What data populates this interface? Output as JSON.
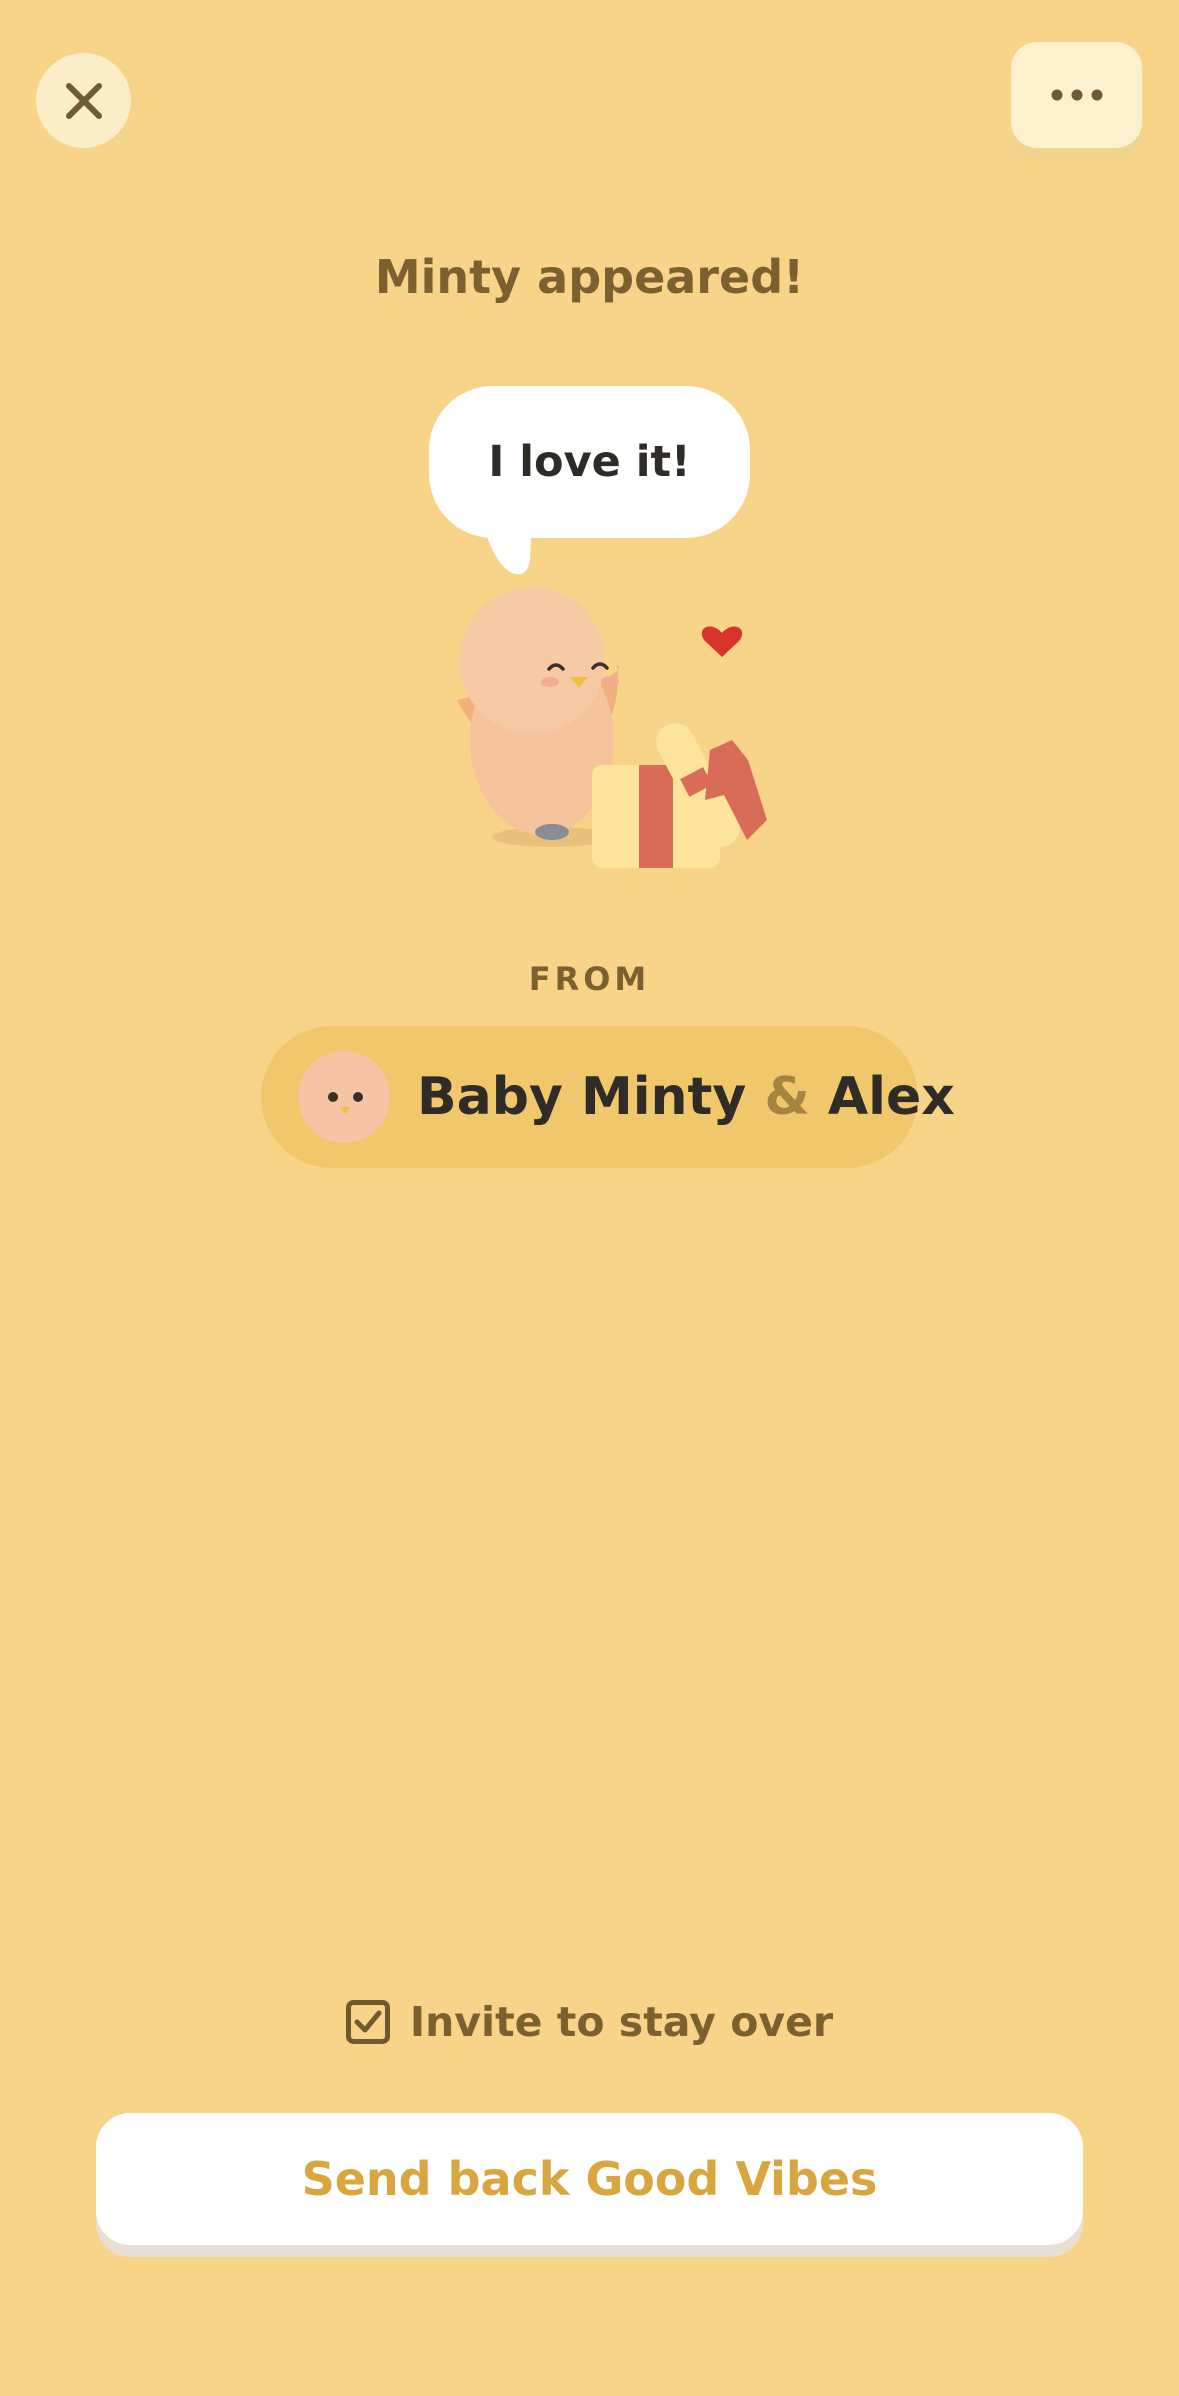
{
  "header": {
    "close_icon": "close-icon",
    "more_icon": "more-horizontal-icon"
  },
  "title": "Minty appeared!",
  "speech_bubble": {
    "text": "I love it!"
  },
  "illustration": {
    "character": "minty-bird",
    "items": [
      "heart",
      "gift-box"
    ]
  },
  "from": {
    "label": "FROM",
    "sender_first": "Baby Minty",
    "ampersand": "&",
    "sender_second": "Alex",
    "avatar_icon": "minty-avatar-icon"
  },
  "invite": {
    "label": "Invite to stay over",
    "checked": true
  },
  "send_button": {
    "label": "Send back Good Vibes"
  },
  "colors": {
    "background": "#f7d488",
    "pill": "#f0c76a",
    "accent_text": "#d8a53f",
    "label_text": "#7b6130",
    "dark_text": "#2f2b26"
  }
}
